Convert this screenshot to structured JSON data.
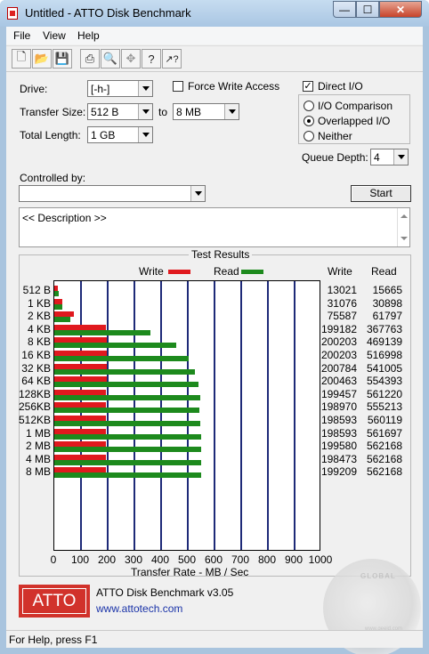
{
  "window": {
    "title": "Untitled - ATTO Disk Benchmark",
    "minimize_glyph": "—",
    "maximize_glyph": "☐",
    "close_glyph": "✕"
  },
  "menu": [
    {
      "label": "File"
    },
    {
      "label": "View"
    },
    {
      "label": "Help"
    }
  ],
  "toolbar": [
    {
      "icon": "new-file-icon",
      "glyph": "🗋"
    },
    {
      "icon": "open-folder-icon",
      "glyph": "📂"
    },
    {
      "icon": "save-icon",
      "glyph": "💾"
    },
    {
      "icon": "print-icon",
      "glyph": "⎙"
    },
    {
      "icon": "print-preview-icon",
      "glyph": "🔍"
    },
    {
      "icon": "move-icon",
      "glyph": "✥"
    },
    {
      "icon": "help-icon",
      "glyph": "?"
    },
    {
      "icon": "context-help-icon",
      "glyph": "↗?"
    }
  ],
  "settings": {
    "drive_label": "Drive:",
    "drive_value": "[-h-]",
    "transfer_size_label": "Transfer Size:",
    "transfer_from": "512 B",
    "to_label": "to",
    "transfer_to": "8 MB",
    "total_length_label": "Total Length:",
    "total_length": "1 GB",
    "force_write_label": "Force Write Access",
    "direct_io_label": "Direct I/O",
    "io_options": [
      {
        "label": "I/O Comparison",
        "selected": false
      },
      {
        "label": "Overlapped I/O",
        "selected": true
      },
      {
        "label": "Neither",
        "selected": false
      }
    ],
    "queue_depth_label": "Queue Depth:",
    "queue_depth": "4",
    "controlled_by_label": "Controlled by:",
    "controlled_by_value": "",
    "start_label": "Start",
    "description": "<< Description >>"
  },
  "results": {
    "title": "Test Results",
    "legend_write": "Write",
    "legend_read": "Read",
    "col_write": "Write",
    "col_read": "Read",
    "xlabel": "Transfer Rate - MB / Sec"
  },
  "chart_data": {
    "type": "bar",
    "title": "Test Results",
    "xlabel": "Transfer Rate - MB / Sec",
    "xlim": [
      0,
      1000
    ],
    "xticks": [
      "0",
      "100",
      "200",
      "300",
      "400",
      "500",
      "600",
      "700",
      "800",
      "900",
      "1000"
    ],
    "categories": [
      "512 B",
      "1 KB",
      "2 KB",
      "4 KB",
      "8 KB",
      "16 KB",
      "32 KB",
      "64 KB",
      "128KB",
      "256KB",
      "512KB",
      "1 MB",
      "2 MB",
      "4 MB",
      "8 MB"
    ],
    "series": [
      {
        "name": "Write",
        "color": "#e0191e",
        "values": [
          13021,
          31076,
          75587,
          199182,
          200203,
          200203,
          200784,
          200463,
          199457,
          198970,
          198593,
          198593,
          199580,
          198473,
          199209
        ]
      },
      {
        "name": "Read",
        "color": "#1d8a1d",
        "values": [
          15665,
          30898,
          61797,
          367763,
          469139,
          516998,
          541005,
          554393,
          561220,
          555213,
          560119,
          561697,
          562168,
          562168,
          562168
        ]
      }
    ],
    "value_units": "KB/s"
  },
  "footer": {
    "logo_text": "ATTO",
    "app_name": "ATTO Disk Benchmark v3.05",
    "url": "www.attotech.com"
  },
  "status": "For Help, press F1"
}
